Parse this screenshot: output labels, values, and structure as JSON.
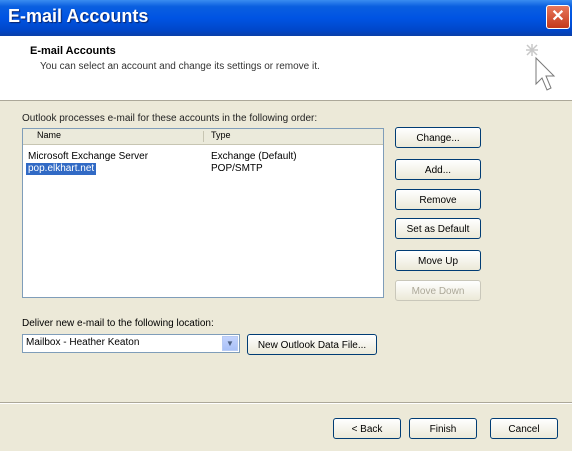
{
  "window": {
    "title": "E-mail Accounts",
    "close_glyph": "✕"
  },
  "header": {
    "title": "E-mail Accounts",
    "subtitle": "You can select an account and change its settings or remove it.",
    "icon": "cursor-sparkle-icon"
  },
  "accounts": {
    "order_label": "Outlook processes e-mail for these accounts in the following order:",
    "columns": {
      "name": "Name",
      "type": "Type"
    },
    "rows": [
      {
        "name": "Microsoft Exchange Server",
        "type": "Exchange (Default)",
        "selected": false
      },
      {
        "name": "pop.elkhart.net",
        "type": "POP/SMTP",
        "selected": true
      }
    ]
  },
  "side_buttons": {
    "change": "Change...",
    "add": "Add...",
    "remove": "Remove",
    "set_default": "Set as Default",
    "move_up": "Move Up",
    "move_down": "Move Down"
  },
  "delivery": {
    "label": "Deliver new e-mail to the following location:",
    "selected": "Mailbox - Heather Keaton",
    "new_file_button": "New Outlook Data File..."
  },
  "footer": {
    "back": "< Back",
    "finish": "Finish",
    "cancel": "Cancel"
  }
}
